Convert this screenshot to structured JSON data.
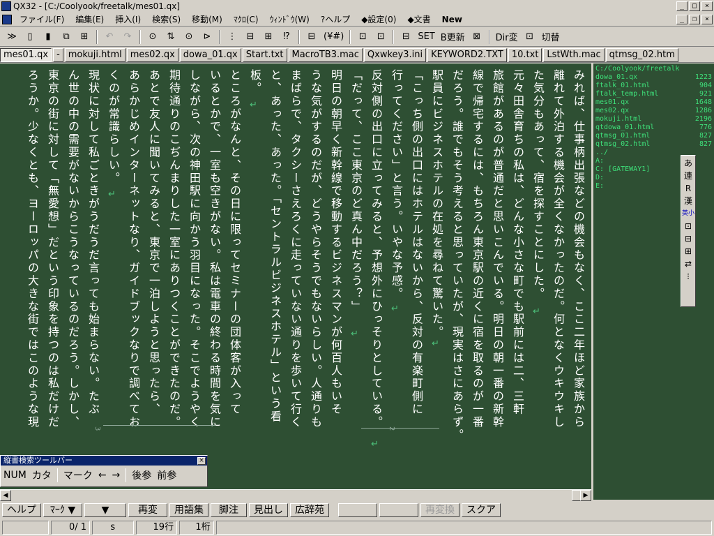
{
  "window": {
    "title": "QX32 - [C:/Coolyook/freetalk/mes01.qx]"
  },
  "menus": [
    "ファイル(F)",
    "編集(E)",
    "挿入(I)",
    "検索(S)",
    "移動(M)",
    "ﾏｸﾛ(C)",
    "ｳｨﾝﾄﾞｳ(W)",
    "?ヘルプ",
    "◆設定(0)",
    "◆文書",
    "New"
  ],
  "toolbar": {
    "items": [
      "≫",
      "▯",
      "▮",
      "⧉",
      "⊞",
      "↶",
      "↷",
      "⊙",
      "⇅",
      "⊙",
      "⊳",
      "⋮",
      "⊟",
      "⊞",
      "⁉",
      "⊟",
      "(¥#)",
      "⊡",
      "⊡",
      "⊟",
      "SET",
      "B更新",
      "⊠",
      "Dir変",
      "⊡",
      "切替"
    ]
  },
  "tabs": [
    "mes01.qx",
    "-",
    "mokuji.html",
    "mes02.qx",
    "dowa_01.qx",
    "Start.txt",
    "MacroTB3.mac",
    "Qxwkey3.ini",
    "KEYWORD2.TXT",
    "10.txt",
    "LstWth.mac",
    "qtmsg_02.htm"
  ],
  "editor": {
    "columns": [
      "みれば、仕事柄出張などの機会もなく、ここ二年ほど家族から",
      "離れて外泊する機会が全くなかったのだ。何となくウキウキし",
      "た気分もあって、宿を探すことにした。",
      "元々田舎育ちの私は、どんな小さな町でも駅前には二、三軒",
      "旅館があるのが普通だと思いこんでいる。明日の朝一番の新幹",
      "線で帰宅するには、もちろん東京駅の近くに宿を取るのが一番",
      "だろう。誰でもそう考えると思っていたが、現実はさにあらず。",
      "駅員にビジネスホテルの在処を尋ねて驚いた。",
      "「こっち側の出口にはホテルはないから、反対の有楽町側に",
      "行ってください」と言う。いやな予感。",
      "反対側の出口に立ってみると、予想外にひっそりとしている。",
      "「だって、ここ東京のど真ん中だろう？」",
      "明日の朝早く新幹線で移動するビジネスマンが何百人もいそ",
      "うな気がするのだが、どうやらそうでもないらしい。人通りも",
      "まばらで、タクシーさえろくに走っていない通りを歩いて行く",
      "と、あった、あった。「セントラルビジネスホテル」という看",
      "板。",
      "ところがなんと、その日に限ってセミナーの団体客が入って",
      "いるとかで、一室も空きがない。私は電車の終わる時間を気に",
      "しながら、次の神田駅に向かう羽目になった。そこでようやく",
      "期待通りのこぢんまりした一室にありつくことができたのだ。",
      "あとで友人に聞いてみると、東京で一泊しようと思ったら、",
      "あらかじめインターネットなり、ガイドブックなりで調べてお",
      "くのが常識らしい。",
      "現状に対して私ごときがうだうだ言っても始まらない。たぶ",
      "ん世の中の需要がないからこうなっているのだろう。しかし、",
      "東京の街に対して「無愛想」だという印象を持つのは私だけだ",
      "ろうか。少なくとも、ヨーロッパの大きな街ではこのような現"
    ],
    "page_numbers": [
      "2",
      "3"
    ],
    "return_mark": "↵"
  },
  "filelist": {
    "path": "C:/Coolyook/freetalk",
    "files": [
      {
        "name": "dowa_01.qx",
        "size": "1223"
      },
      {
        "name": "ftalk_01.html",
        "size": "904"
      },
      {
        "name": "ftalk_temp.html",
        "size": "921"
      },
      {
        "name": "mes01.qx",
        "size": "1648"
      },
      {
        "name": "mes02.qx",
        "size": "1286"
      },
      {
        "name": "mokuji.html",
        "size": "2196"
      },
      {
        "name": "qtdowa_01.html",
        "size": "776"
      },
      {
        "name": "qtmsg_01.html",
        "size": "827"
      },
      {
        "name": "qtmsg_02.html",
        "size": "827"
      }
    ],
    "drives": [
      "../",
      "A:",
      "C: [GATEWAY1]",
      "D:",
      "E:"
    ]
  },
  "sidepalette": [
    "あ",
    "連",
    "R",
    "漢",
    "英小",
    "⊡",
    "⊟",
    "⊞",
    "⇄",
    "⁝"
  ],
  "searchbar": {
    "title": "縦書検索ツールバー",
    "close": "×",
    "items": [
      "NUM",
      "カタ",
      "マーク",
      "←",
      "→",
      "後参",
      "前参"
    ]
  },
  "fnkeys": [
    "ヘルプ",
    "ﾏｰｸ ▼",
    "▼",
    "再変",
    "用語集",
    "脚注",
    "見出し",
    "広辞苑",
    "",
    "",
    "再変換",
    "スクア"
  ],
  "status": {
    "page": "0/ 1",
    "mode": "s",
    "line": "19行",
    "col": "1桁"
  },
  "colors": {
    "editor_bg": "#2e4f33",
    "text": "#ffffff",
    "filelist_text": "#3ee07a",
    "return_mark": "#4cc07a",
    "title_active": "#0a246a"
  }
}
